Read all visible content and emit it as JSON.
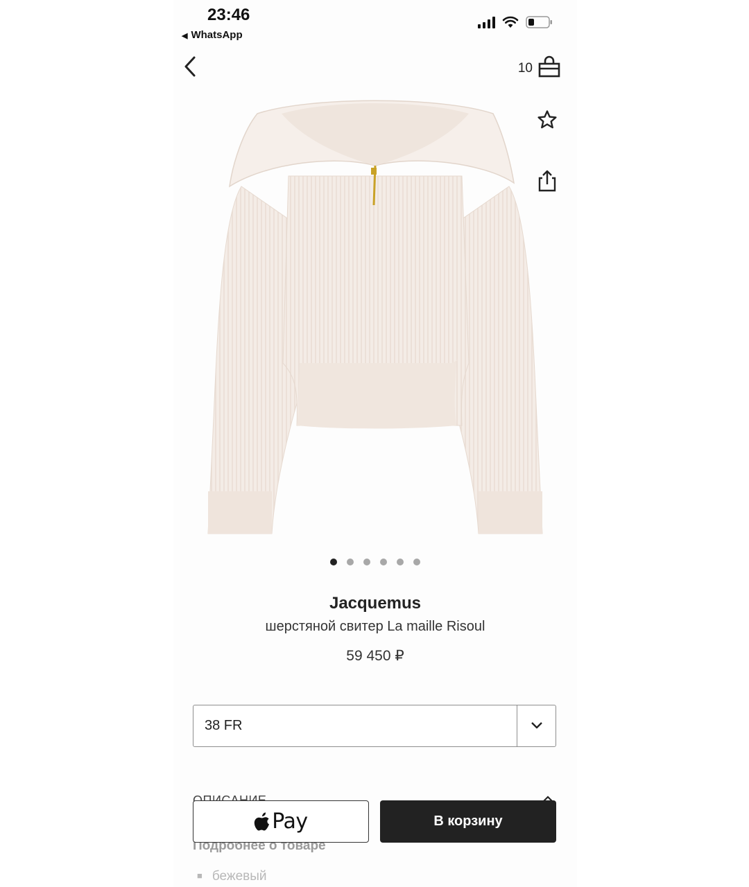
{
  "status_bar": {
    "time": "23:46",
    "back_app": "WhatsApp"
  },
  "header": {
    "cart_count": "10"
  },
  "product": {
    "brand": "Jacquemus",
    "name": "шерстяной свитер La maille Risoul",
    "price": "59 450 ₽",
    "image_count": 6,
    "active_image": 0
  },
  "size_select": {
    "value": "38 FR"
  },
  "description": {
    "header": "ОПИСАНИЕ",
    "more_label": "Подробнее о товаре",
    "items": [
      "бежевый"
    ]
  },
  "actions": {
    "apple_pay_label": "Pay",
    "add_to_cart_label": "В корзину"
  },
  "colors": {
    "primary_button": "#222222",
    "sweater": "#f3e9e2",
    "zipper": "#c9a227"
  }
}
